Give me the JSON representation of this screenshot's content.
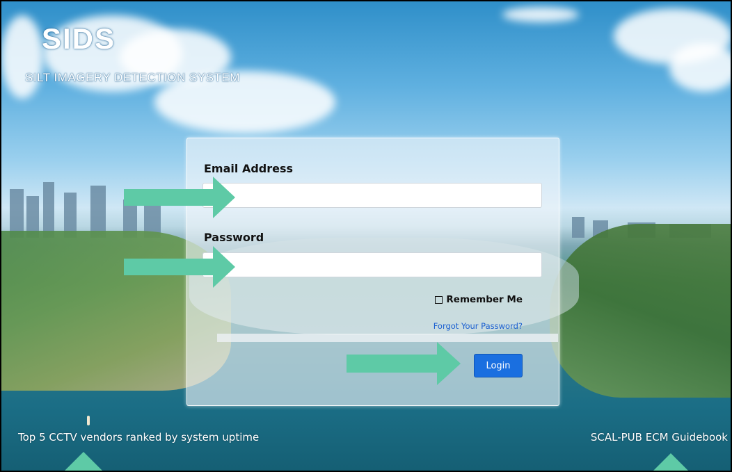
{
  "app": {
    "logo": "SIDS",
    "subtitle": "SILT IMAGERY DETECTION SYSTEM"
  },
  "login_form": {
    "email_label": "Email Address",
    "email_value": "",
    "password_label": "Password",
    "password_value": "",
    "remember_label": "Remember Me",
    "remember_checked": false,
    "forgot_link": "Forgot Your Password?",
    "login_button": "Login"
  },
  "footer": {
    "left_link": "Top 5 CCTV vendors ranked by system uptime",
    "right_link": "SCAL-PUB ECM Guidebook"
  },
  "colors": {
    "accent": "#1a6fe0",
    "annotation_arrow": "#5ecaa6",
    "link": "#1a5fd0"
  },
  "icons": [
    "arrow-right-icon",
    "arrow-up-icon",
    "checkbox-icon"
  ]
}
